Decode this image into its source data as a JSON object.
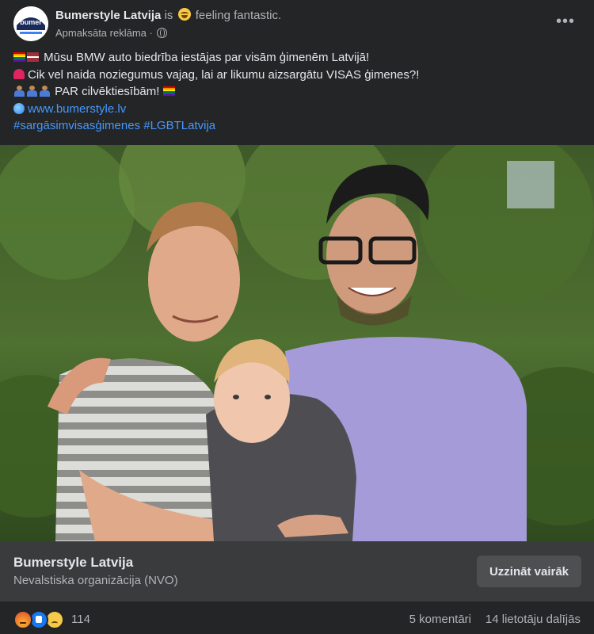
{
  "post": {
    "page_name": "Bumerstyle Latvija",
    "is_text": "is",
    "feeling_text": "feeling fantastic.",
    "sponsored_label": "Apmaksāta reklāma",
    "separator": "·",
    "more_label": "•••",
    "avatar_logo_text": "bumer"
  },
  "body": {
    "line1": "Mūsu BMW auto biedrība iestājas par visām ģimenēm Latvijā!",
    "line2": "Cik vel naida noziegumus vajag, lai ar likumu aizsargātu VISAS ģimenes?!",
    "line3": "PAR cilvēktiesībām!",
    "link": "www.bumerstyle.lv",
    "hashtag1": "#sargāsimvisasģimenes",
    "hashtag2": "#LGBTLatvija"
  },
  "cta": {
    "title": "Bumerstyle Latvija",
    "subtitle": "Nevalstiska organizācija (NVO)",
    "button_label": "Uzzināt vairāk"
  },
  "footer": {
    "reaction_count": "114",
    "comments": "5 komentāri",
    "shares": "14 lietotāju dalījās"
  },
  "colors": {
    "background": "#242526",
    "cta_background": "#3a3b3c",
    "link": "#4599ff",
    "text_primary": "#e4e6eb",
    "text_secondary": "#b0b3b8"
  },
  "icons": [
    "page-avatar-logo",
    "grinning-face-emoji",
    "globe-icon",
    "more-options-icon",
    "rainbow-flag-emoji",
    "latvia-flag-emoji",
    "siren-emoji",
    "couple-emoji",
    "globe-emoji",
    "angry-reaction-icon",
    "like-reaction-icon",
    "sad-reaction-icon"
  ]
}
